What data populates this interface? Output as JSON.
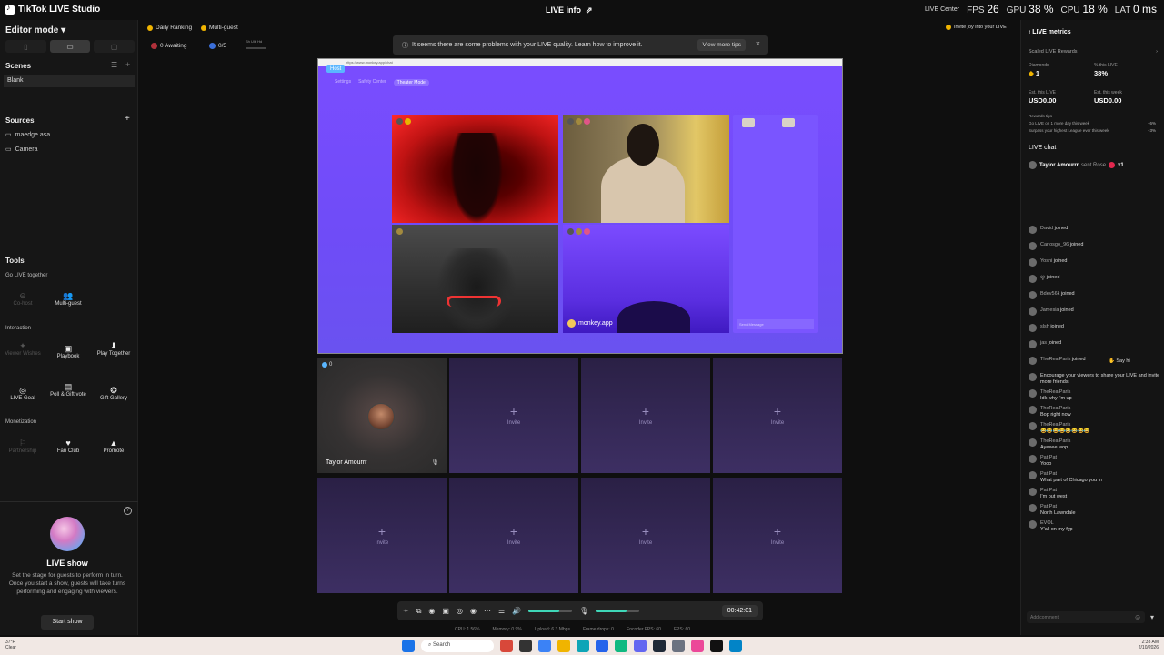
{
  "titlebar": {
    "app_name": "TikTok LIVE Studio",
    "center_label": "LIVE info",
    "live_center": "LIVE Center",
    "stats": [
      {
        "label": "FPS",
        "value": "26"
      },
      {
        "label": "GPU",
        "value": "38 %"
      },
      {
        "label": "CPU",
        "value": "18 %"
      },
      {
        "label": "LAT",
        "value": "0 ms"
      }
    ]
  },
  "left": {
    "editor_mode": "Editor mode",
    "scenes_header": "Scenes",
    "scene_item": "Blank",
    "sources_header": "Sources",
    "sources": [
      "maedge.asa",
      "Camera"
    ],
    "tools_header": "Tools",
    "go_live_together": "Go LIVE together",
    "tools_row1": [
      {
        "label": "Co-host",
        "icon": "cohost-icon",
        "dim": true
      },
      {
        "label": "Multi-guest",
        "icon": "multi-guest-icon",
        "dim": false
      }
    ],
    "interaction_header": "Interaction",
    "tools_row2": [
      {
        "label": "Viewer Wishes",
        "icon": "wishes-icon",
        "dim": true
      },
      {
        "label": "Playbook",
        "icon": "playbook-icon",
        "dim": false
      },
      {
        "label": "Play Together",
        "icon": "play-together-icon",
        "dim": false
      }
    ],
    "tools_row3": [
      {
        "label": "LIVE Goal",
        "icon": "goal-icon",
        "dim": false
      },
      {
        "label": "Poll & Gift vote",
        "icon": "poll-icon",
        "dim": false
      },
      {
        "label": "Gift Gallery",
        "icon": "gift-gallery-icon",
        "dim": false
      }
    ],
    "monetization_header": "Monetization",
    "tools_row4": [
      {
        "label": "Partnership",
        "icon": "partnership-icon",
        "dim": true
      },
      {
        "label": "Fan Club",
        "icon": "fan-club-icon",
        "dim": false
      },
      {
        "label": "Promote",
        "icon": "promote-icon",
        "dim": false
      }
    ],
    "live_show_title": "LIVE show",
    "live_show_desc": "Set the stage for guests to perform in turn. Once you start a show, guests will take turns performing and engaging with viewers.",
    "start_show": "Start show"
  },
  "top_pills": {
    "daily_ranking": "Daily Ranking",
    "multi_guest": "Multi-guest",
    "awaiting": "0 Awaiting",
    "progress_label": "0/5",
    "small_label": "Sh Ulb Hd"
  },
  "banner": {
    "text": "It seems there are some problems with your LIVE quality. Learn how to improve it.",
    "tips_button": "View more tips"
  },
  "stage": {
    "url": "https://www.monkey.app/chat",
    "host_badge": "Host",
    "tabs": [
      "Settings",
      "Safety Center",
      "Theater Mode"
    ],
    "monkey_label": "monkey.app",
    "send_placeholder": "Send Message"
  },
  "guests": {
    "count": "0",
    "guest_name": "Taylor Amourrr",
    "invite_label": "Invite"
  },
  "controls": {
    "timer": "00:42:01",
    "volume_pct": 70,
    "mic_pct": 70
  },
  "statsline": {
    "cpu": "CPU: 1.56%",
    "memory": "Memory: 0.9%",
    "upload": "Upload: 6.3 Mbps",
    "frame_drops": "Frame drops: 0",
    "encoder_fps": "Encoder FPS: 60",
    "fps": "FPS: 60"
  },
  "right": {
    "invite_joy": "Invite joy into your LIVE",
    "metrics_title": "LIVE metrics",
    "scaled_rewards": "Scaled LIVE Rewards",
    "diamonds_label": "Diamonds",
    "diamonds_value": "1",
    "pct_label": "% this LIVE",
    "pct_value": "38%",
    "est_live_label": "Est. this LIVE",
    "est_live_value": "USD0.00",
    "est_week_label": "Est. this week",
    "est_week_value": "USD0.00",
    "tips_header": "Rewards tips",
    "tips": [
      {
        "text": "Go LIVE on 1 more day this week",
        "value": "+6%"
      },
      {
        "text": "Surpass your highest League ever this week",
        "value": "+3%"
      }
    ],
    "chat_header": "LIVE chat",
    "gift_user": "Taylor Amourrr",
    "gift_text": "sent Rose",
    "gift_count": "x1",
    "say_hi": "Say hi",
    "chat": [
      {
        "user": "David",
        "text": "joined"
      },
      {
        "user": "Carlosgo_96",
        "text": "joined"
      },
      {
        "user": "Yoshi",
        "text": "joined"
      },
      {
        "user": "ꨄ",
        "text": "joined"
      },
      {
        "user": "Bdev56k",
        "text": "joined"
      },
      {
        "user": "Jamesia",
        "text": "joined"
      },
      {
        "user": "slsh",
        "text": "joined"
      },
      {
        "user": "jas",
        "text": "joined"
      },
      {
        "user": "TheRealParis",
        "text": "joined"
      },
      {
        "user": "",
        "text": "Encourage your viewers to share your LIVE and invite more friends!"
      },
      {
        "user": "TheRealParis",
        "text": "Idk why i'm up"
      },
      {
        "user": "TheRealParis",
        "text": "Bop right now"
      },
      {
        "user": "TheRealParis",
        "text": "😂😂😂😂😂😂😂😂"
      },
      {
        "user": "TheRealParis",
        "text": "Ayeeee wop"
      },
      {
        "user": "Pat Pat",
        "text": "Yooo"
      },
      {
        "user": "Pat Pat",
        "text": "What part of Chicago you in"
      },
      {
        "user": "Pat Pat",
        "text": "I'm out west"
      },
      {
        "user": "Pat Pat",
        "text": "North Lawndale"
      },
      {
        "user": "EVOL",
        "text": "Y'all on my fyp"
      }
    ],
    "comment_placeholder": "Add comment"
  },
  "taskbar": {
    "weather_temp": "37°F",
    "weather_desc": "Clear",
    "search": "Search",
    "time": "2:33 AM",
    "date": "2/10/2026"
  }
}
